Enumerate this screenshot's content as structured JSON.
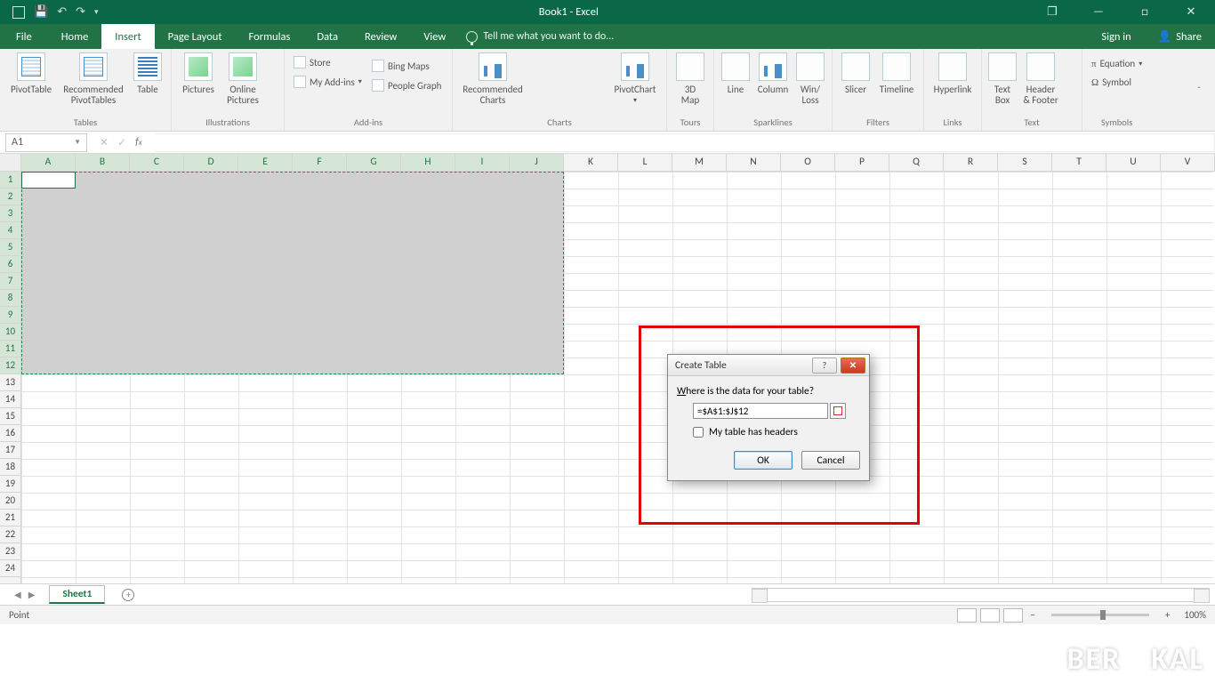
{
  "title": "Book1 - Excel",
  "window_controls": {
    "restore": "❐",
    "minimize": "—",
    "maximize": "□",
    "close": "✕"
  },
  "tabs": {
    "file": "File",
    "list": [
      "Home",
      "Insert",
      "Page Layout",
      "Formulas",
      "Data",
      "Review",
      "View"
    ],
    "active": "Insert",
    "tell_me": "Tell me what you want to do...",
    "sign_in": "Sign in",
    "share": "Share"
  },
  "ribbon": {
    "tables": {
      "label": "Tables",
      "pivot": "PivotTable",
      "rec_pivot": "Recommended\nPivotTables",
      "table": "Table"
    },
    "illustrations": {
      "label": "Illustrations",
      "pictures": "Pictures",
      "online_pics": "Online\nPictures"
    },
    "addins": {
      "label": "Add-ins",
      "store": "Store",
      "my": "My Add-ins",
      "bing": "Bing Maps",
      "people": "People Graph"
    },
    "charts": {
      "label": "Charts",
      "rec": "Recommended\nCharts",
      "pivotchart": "PivotChart"
    },
    "tours": {
      "label": "Tours",
      "map": "3D\nMap"
    },
    "sparklines": {
      "label": "Sparklines",
      "line": "Line",
      "col": "Column",
      "wl": "Win/\nLoss"
    },
    "filters": {
      "label": "Filters",
      "slicer": "Slicer",
      "timeline": "Timeline"
    },
    "links": {
      "label": "Links",
      "hyper": "Hyperlink"
    },
    "text": {
      "label": "Text",
      "tb": "Text\nBox",
      "hf": "Header\n& Footer"
    },
    "symbols": {
      "label": "Symbols",
      "eq": "Equation",
      "sym": "Symbol"
    }
  },
  "namebox": "A1",
  "columns": [
    "A",
    "B",
    "C",
    "D",
    "E",
    "F",
    "G",
    "H",
    "I",
    "J",
    "K",
    "L",
    "M",
    "N",
    "O",
    "P",
    "Q",
    "R",
    "S",
    "T",
    "U",
    "V"
  ],
  "rows_visible": 24,
  "selected_cols": 10,
  "selected_rows": 12,
  "sheets": {
    "active": "Sheet1"
  },
  "status": {
    "mode": "Point",
    "zoom": "100%"
  },
  "dialog": {
    "title": "Create Table",
    "question": "Where is the data for your table?",
    "question_u": "W",
    "range": "=$A$1:$J$12",
    "headers_label": "y table has headers",
    "headers_u": "M",
    "ok": "OK",
    "cancel": "Cancel"
  },
  "watermark": "BERAKAL"
}
